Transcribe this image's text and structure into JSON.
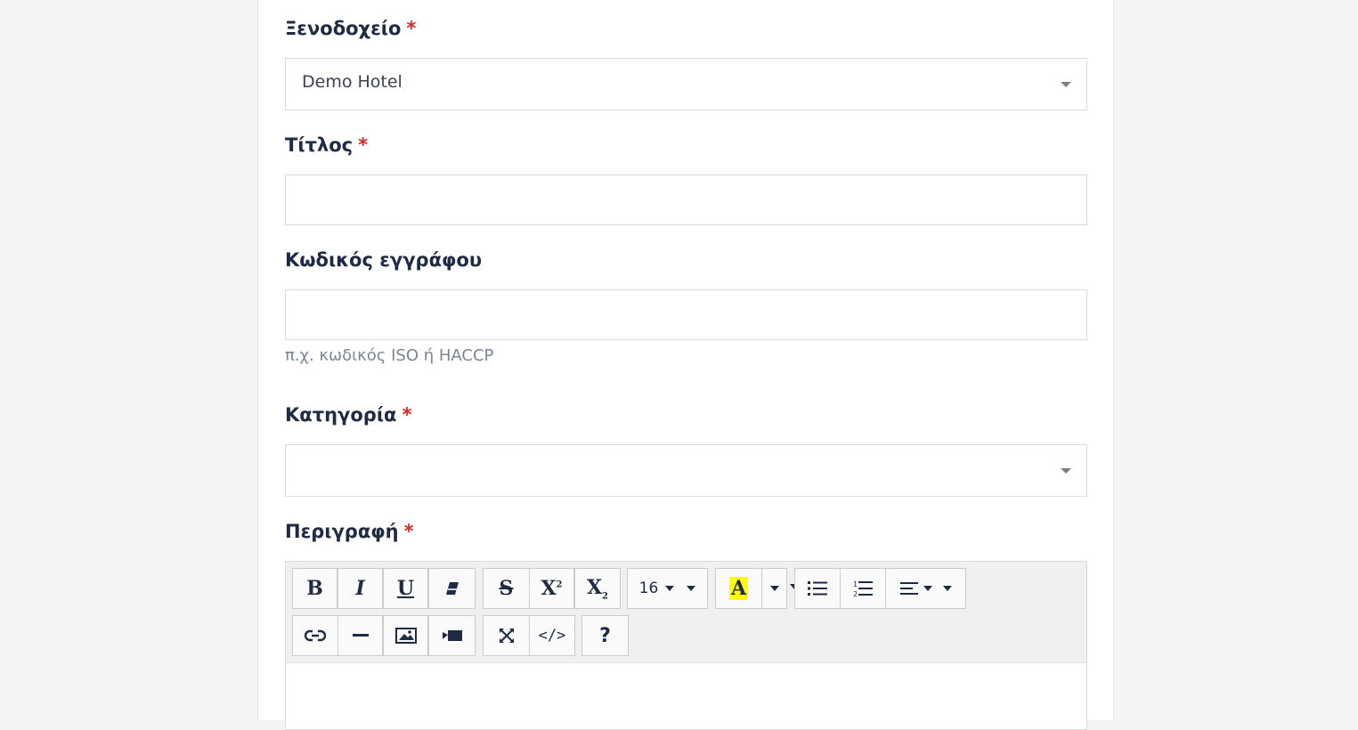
{
  "form": {
    "hotel": {
      "label": "Ξενοδοχείο",
      "required_mark": "*",
      "value": "Demo Hotel"
    },
    "title": {
      "label": "Τίτλος",
      "required_mark": "*",
      "value": ""
    },
    "doc_code": {
      "label": "Κωδικός εγγράφου",
      "value": "",
      "help": "π.χ. κωδικός ISO ή HACCP"
    },
    "category": {
      "label": "Κατηγορία",
      "required_mark": "*",
      "value": ""
    },
    "description": {
      "label": "Περιγραφή",
      "required_mark": "*"
    }
  },
  "editor": {
    "font_size": "16",
    "highlight_color": "#ffff00",
    "buttons": [
      "bold-icon",
      "italic-icon",
      "underline-icon",
      "eraser-icon",
      "strikethrough-icon",
      "superscript-icon",
      "subscript-icon",
      "font-size-dropdown",
      "highlight-icon",
      "list-ul-icon",
      "list-ol-icon",
      "align-icon",
      "link-icon",
      "horizontal-rule-icon",
      "image-icon",
      "video-icon",
      "fullscreen-icon",
      "code-view-icon",
      "help-icon"
    ]
  }
}
